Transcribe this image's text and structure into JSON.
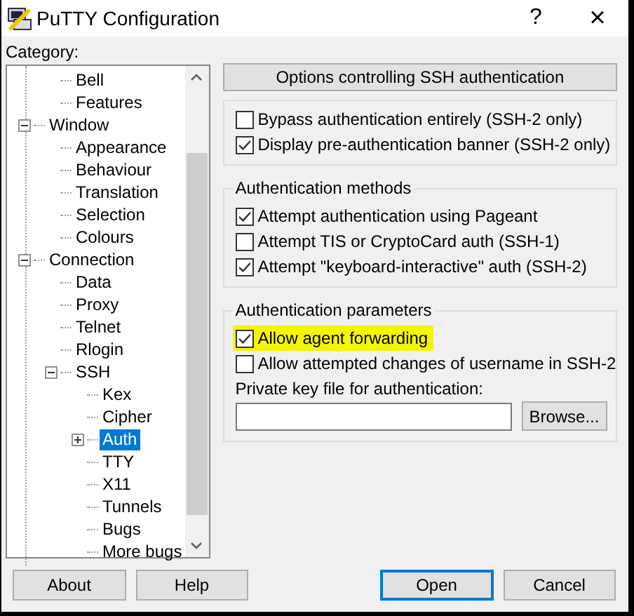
{
  "window": {
    "title": "PuTTY Configuration",
    "help": "?",
    "close": "×"
  },
  "category_label": "Category:",
  "tree": [
    {
      "children": [
        {
          "label": "Bell",
          "selected": false
        },
        {
          "label": "Features",
          "selected": false
        }
      ]
    },
    {
      "label": "Window",
      "selected": false,
      "expanded": true,
      "children": [
        {
          "label": "Appearance",
          "selected": false
        },
        {
          "label": "Behaviour",
          "selected": false
        },
        {
          "label": "Translation",
          "selected": false
        },
        {
          "label": "Selection",
          "selected": false
        },
        {
          "label": "Colours",
          "selected": false
        }
      ]
    },
    {
      "label": "Connection",
      "selected": false,
      "expanded": true,
      "children": [
        {
          "label": "Data",
          "selected": false
        },
        {
          "label": "Proxy",
          "selected": false
        },
        {
          "label": "Telnet",
          "selected": false
        },
        {
          "label": "Rlogin",
          "selected": false
        },
        {
          "label": "SSH",
          "selected": false,
          "expanded": true,
          "children": [
            {
              "label": "Kex",
              "selected": false
            },
            {
              "label": "Cipher",
              "selected": false
            },
            {
              "label": "Auth",
              "selected": true,
              "expanded": false
            },
            {
              "label": "TTY",
              "selected": false
            },
            {
              "label": "X11",
              "selected": false
            },
            {
              "label": "Tunnels",
              "selected": false
            },
            {
              "label": "Bugs",
              "selected": false
            },
            {
              "label": "More bugs",
              "selected": false
            }
          ]
        }
      ]
    }
  ],
  "header": "Options controlling SSH authentication",
  "groups": [
    {
      "items": [
        {
          "kind": "checkbox",
          "label": "Bypass authentication entirely (SSH-2 only)",
          "checked": false
        },
        {
          "kind": "checkbox",
          "label": "Display pre-authentication banner (SSH-2 only)",
          "checked": true
        }
      ]
    },
    {
      "title": "Authentication methods",
      "items": [
        {
          "kind": "checkbox",
          "label": "Attempt authentication using Pageant",
          "checked": true
        },
        {
          "kind": "checkbox",
          "label": "Attempt TIS or CryptoCard auth (SSH-1)",
          "checked": false
        },
        {
          "kind": "checkbox",
          "label": "Attempt \"keyboard-interactive\" auth (SSH-2)",
          "checked": true
        }
      ]
    },
    {
      "title": "Authentication parameters",
      "items": [
        {
          "kind": "checkbox",
          "label": "Allow agent forwarding",
          "checked": true,
          "highlighted": true
        },
        {
          "kind": "checkbox",
          "label": "Allow attempted changes of username in SSH-2",
          "checked": false
        },
        {
          "kind": "file",
          "label": "Private key file for authentication:",
          "button": "Browse..."
        }
      ]
    }
  ],
  "buttons": [
    {
      "label": "About",
      "default": false
    },
    {
      "label": "Help",
      "default": false
    },
    {
      "label": "Open",
      "default": true
    },
    {
      "label": "Cancel",
      "default": false
    }
  ]
}
